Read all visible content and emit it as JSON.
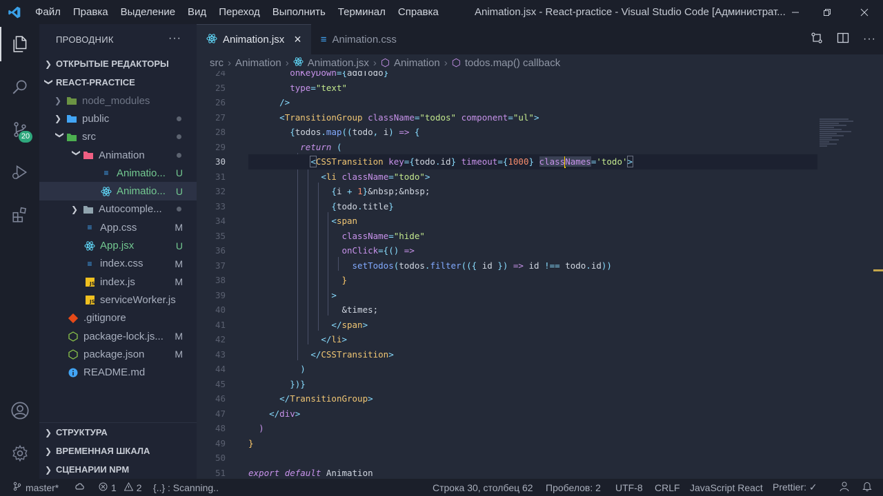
{
  "menu": [
    "Файл",
    "Правка",
    "Выделение",
    "Вид",
    "Переход",
    "Выполнить",
    "Терминал",
    "Справка"
  ],
  "window_title": "Animation.jsx - React-practice - Visual Studio Code [Администрат...",
  "activity": {
    "scm_badge": "20"
  },
  "sidebar": {
    "title": "ПРОВОДНИК",
    "more": "···",
    "open_editors": "ОТКРЫТЫЕ РЕДАКТОРЫ",
    "project": "REACT-PRACTICE",
    "tree": [
      {
        "name": "node_modules",
        "status": ""
      },
      {
        "name": "public",
        "status": ""
      },
      {
        "name": "src",
        "status": ""
      },
      {
        "name": "Animation",
        "status": ""
      },
      {
        "name": "Animatio...",
        "status": "U"
      },
      {
        "name": "Animatio...",
        "status": "U"
      },
      {
        "name": "Autocomple...",
        "status": ""
      },
      {
        "name": "App.css",
        "status": "M"
      },
      {
        "name": "App.jsx",
        "status": "U"
      },
      {
        "name": "index.css",
        "status": "M"
      },
      {
        "name": "index.js",
        "status": "M"
      },
      {
        "name": "serviceWorker.js",
        "status": ""
      },
      {
        "name": ".gitignore",
        "status": ""
      },
      {
        "name": "package-lock.js...",
        "status": "M"
      },
      {
        "name": "package.json",
        "status": "M"
      },
      {
        "name": "README.md",
        "status": ""
      }
    ],
    "sections_bottom": [
      "СТРУКТУРА",
      "ВРЕМЕННАЯ ШКАЛА",
      "СЦЕНАРИИ NPM"
    ]
  },
  "tabs": [
    {
      "label": "Animation.jsx",
      "close": "×"
    },
    {
      "label": "Animation.css"
    }
  ],
  "breadcrumb": [
    "src",
    "Animation",
    "Animation.jsx",
    "Animation",
    "todos.map() callback"
  ],
  "statusbar": {
    "branch": "master*",
    "errors": "1",
    "warnings": "2",
    "scanning": "{..} : Scanning..",
    "position": "Строка 30, столбец 62",
    "spaces": "Пробелов: 2",
    "encoding": "UTF-8",
    "eol": "CRLF",
    "language": "JavaScript React",
    "prettier": "Prettier: ✓"
  },
  "colors": {
    "accent": "#2fa87d",
    "modified": "#e2c08d",
    "untracked": "#73c991",
    "cursor": "#ffcc00"
  }
}
